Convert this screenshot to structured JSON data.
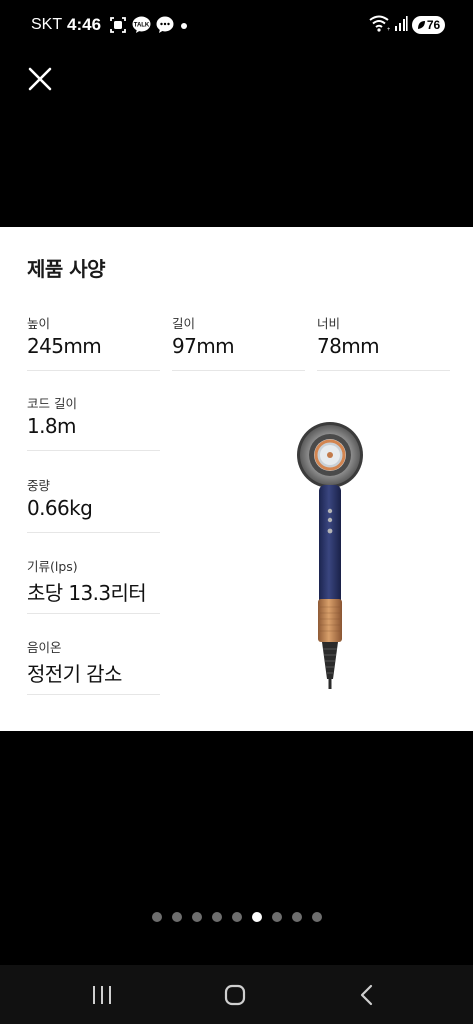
{
  "status_bar": {
    "carrier": "SKT",
    "time": "4:46",
    "notification_icons": [
      "gallery-icon",
      "kakaotalk-icon",
      "message-bubble-icon",
      "dot-icon"
    ],
    "kakao_badge": "TALK",
    "battery_level": "76",
    "status_icons": [
      "wifi-icon",
      "signal-icon",
      "battery-icon"
    ]
  },
  "toolbar": {
    "close_icon": "close-icon"
  },
  "spec_card": {
    "title": "제품 사양",
    "specs": [
      {
        "label": "높이",
        "value": "245mm"
      },
      {
        "label": "길이",
        "value": "97mm"
      },
      {
        "label": "너비",
        "value": "78mm"
      },
      {
        "label": "코드 길이",
        "value": "1.8m"
      },
      {
        "label": "중량",
        "value": "0.66kg"
      },
      {
        "label": "기류(lps)",
        "value": "초당 13.3리터"
      },
      {
        "label": "음이온",
        "value": "정전기 감소"
      }
    ],
    "colors": {
      "dryer_body": "#2b3566",
      "dryer_copper": "#c98a5a",
      "background": "#ffffff"
    }
  },
  "pager": {
    "total": 9,
    "active_index": 5
  },
  "nav_bar": {
    "items": [
      "recent-apps-icon",
      "home-icon",
      "back-icon"
    ]
  }
}
